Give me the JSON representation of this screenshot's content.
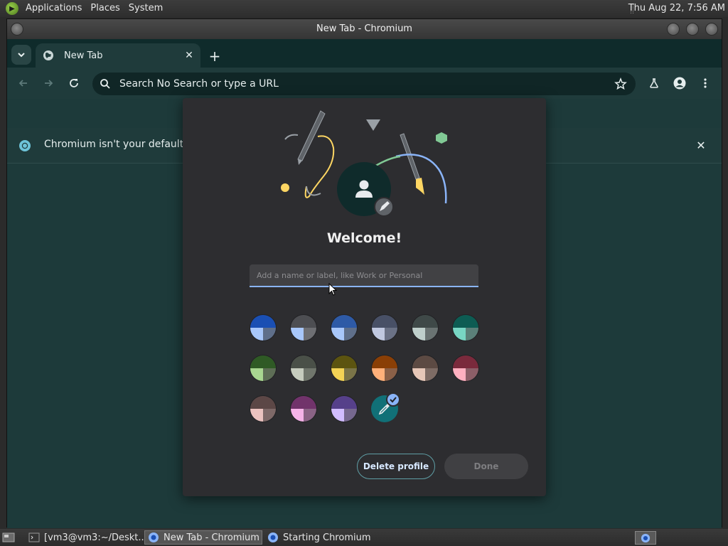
{
  "top_panel": {
    "menus": [
      "Applications",
      "Places",
      "System"
    ],
    "clock": "Thu Aug 22,  7:56 AM"
  },
  "window": {
    "title": "New Tab - Chromium"
  },
  "tabs": {
    "active_tab_title": "New Tab",
    "new_tab_symbol": "+"
  },
  "toolbar": {
    "omnibox_text": "Search No Search or type a URL"
  },
  "infobar": {
    "text": "Chromium isn't your default bro"
  },
  "dialog": {
    "title": "Welcome!",
    "name_placeholder": "Add a name or label, like Work or Personal",
    "delete_label": "Delete profile",
    "done_label": "Done",
    "color_swatches": [
      {
        "top": "#1a4fb3",
        "bl": "#a8c7fa",
        "br": "#5f6f8a"
      },
      {
        "top": "#4d4e52",
        "bl": "#a8c7fa",
        "br": "#6e6f73"
      },
      {
        "top": "#2e5aa6",
        "bl": "#a8c7fa",
        "br": "#5f6f8a"
      },
      {
        "top": "#485066",
        "bl": "#c0c8e0",
        "br": "#6b7286"
      },
      {
        "top": "#3f4948",
        "bl": "#bfcfcb",
        "br": "#6a7372"
      },
      {
        "top": "#0d5c53",
        "bl": "#78d6c4",
        "br": "#5b8079"
      },
      {
        "top": "#2f5a25",
        "bl": "#a8d690",
        "br": "#5e6e56"
      },
      {
        "top": "#4a5048",
        "bl": "#c6ccbe",
        "br": "#70766c"
      },
      {
        "top": "#5c5410",
        "bl": "#f3d355",
        "br": "#7a7448"
      },
      {
        "top": "#8a3f06",
        "bl": "#ffb07a",
        "br": "#8a6048"
      },
      {
        "top": "#5c4a43",
        "bl": "#e6c7b8",
        "br": "#7e6c65"
      },
      {
        "top": "#7a2a3c",
        "bl": "#ffb0c0",
        "br": "#8c5f68"
      },
      {
        "top": "#5c4746",
        "bl": "#ecc3c0",
        "br": "#7e6968"
      },
      {
        "top": "#71336b",
        "bl": "#f5b3e8",
        "br": "#8a6385"
      },
      {
        "top": "#56408a",
        "bl": "#d1bcff",
        "br": "#76688f"
      }
    ],
    "custom_color": "#117077",
    "selected_badge_color": "#8ab4f8"
  },
  "taskbar": {
    "items": [
      {
        "label": "[vm3@vm3:~/Deskt..."
      },
      {
        "label": "New Tab - Chromium"
      },
      {
        "label": "Starting Chromium"
      }
    ]
  }
}
